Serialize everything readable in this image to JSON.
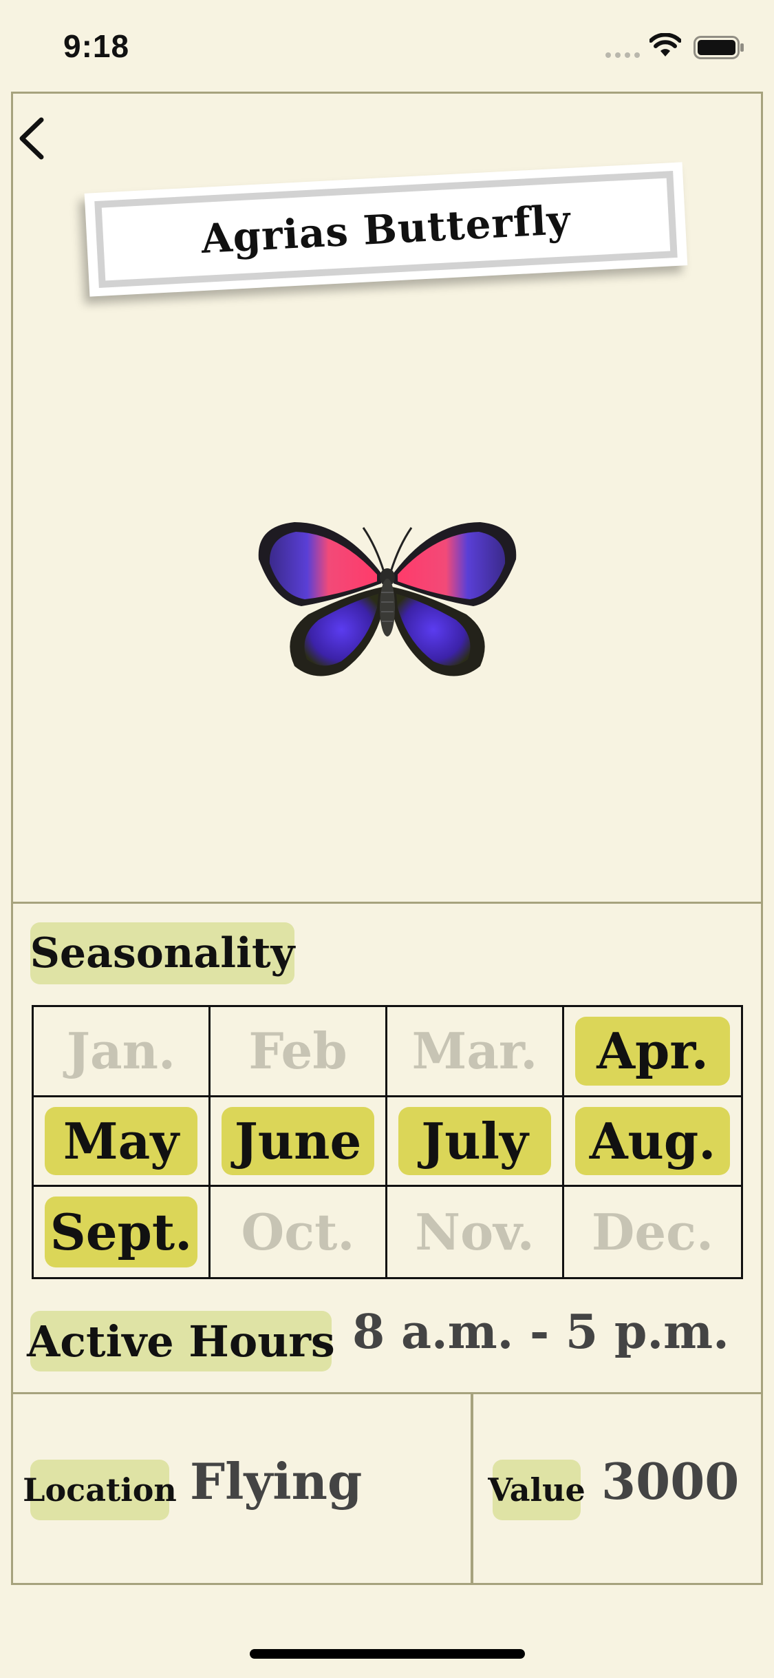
{
  "status_bar": {
    "time": "9:18",
    "icons": [
      "signal-dots-icon",
      "wifi-icon",
      "battery-icon"
    ]
  },
  "navigation": {
    "back_icon": "chevron-left-icon"
  },
  "title": "Agrias Butterfly",
  "image": {
    "icon": "butterfly-icon"
  },
  "seasonality": {
    "label": "Seasonality",
    "months": [
      {
        "label": "Jan.",
        "active": false
      },
      {
        "label": "Feb",
        "active": false
      },
      {
        "label": "Mar.",
        "active": false
      },
      {
        "label": "Apr.",
        "active": true
      },
      {
        "label": "May",
        "active": true
      },
      {
        "label": "June",
        "active": true
      },
      {
        "label": "July",
        "active": true
      },
      {
        "label": "Aug.",
        "active": true
      },
      {
        "label": "Sept.",
        "active": true
      },
      {
        "label": "Oct.",
        "active": false
      },
      {
        "label": "Nov.",
        "active": false
      },
      {
        "label": "Dec.",
        "active": false
      }
    ]
  },
  "active_hours": {
    "label": "Active Hours",
    "value": "8 a.m. - 5 p.m."
  },
  "location": {
    "label": "Location",
    "value": "Flying"
  },
  "value": {
    "label": "Value",
    "value": "3000"
  },
  "colors": {
    "background": "#f7f3e1",
    "frame": "#a6a27d",
    "label_bg": "#dfe3a5",
    "active_month": "#dbd658",
    "inactive_month_text": "#c7c4b4"
  }
}
